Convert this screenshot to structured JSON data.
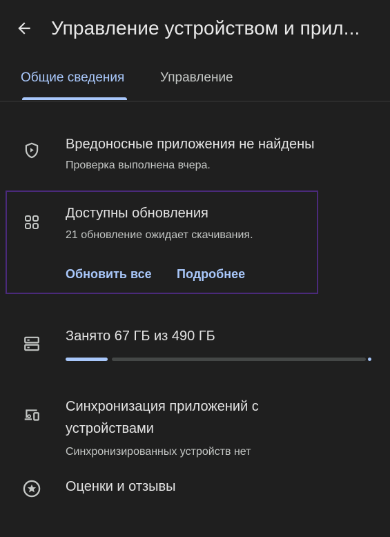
{
  "header": {
    "back_icon": "arrow-back-icon",
    "title": "Управление устройством и прил..."
  },
  "tabs": [
    {
      "label": "Общие сведения",
      "selected": true
    },
    {
      "label": "Управление",
      "selected": false
    }
  ],
  "malware": {
    "icon": "shield-play-icon",
    "title": "Вредоносные приложения не найдены",
    "subtitle": "Проверка выполнена вчера."
  },
  "updates": {
    "icon": "apps-grid-icon",
    "title": "Доступны обновления",
    "subtitle": "21 обновление ожидает скачивания.",
    "update_all_label": "Обновить все",
    "details_label": "Подробнее"
  },
  "storage": {
    "icon": "storage-icon",
    "title": "Занято 67 ГБ из 490 ГБ",
    "used_gb": 67,
    "total_gb": 490
  },
  "sync": {
    "icon": "devices-icon",
    "title_line1": "Синхронизация приложений с",
    "title_line2": "устройствами",
    "subtitle": "Синхронизированных устройств нет"
  },
  "ratings": {
    "icon": "star-circle-icon",
    "title": "Оценки и отзывы"
  },
  "colors": {
    "background": "#1f1f1f",
    "accent": "#a8c7fa",
    "highlight_border": "#4a2a7a",
    "text_primary": "#e3e3e3",
    "text_secondary": "#c4c7c5"
  }
}
